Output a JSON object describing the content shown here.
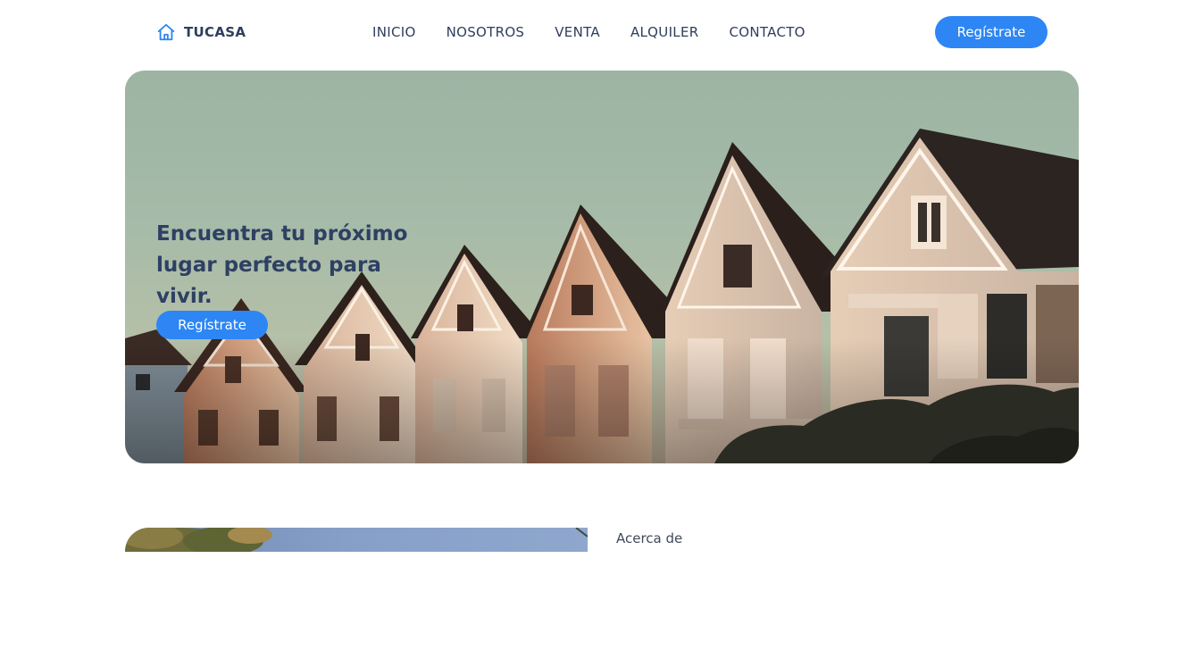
{
  "navbar": {
    "brand": "TUCASA",
    "brand_icon": "home-icon",
    "links": [
      "INICIO",
      "NOSOTROS",
      "VENTA",
      "ALQUILER",
      "CONTACTO"
    ],
    "cta_label": "Regístrate"
  },
  "hero": {
    "title": "Encuentra tu próximo lugar perfecto para vivir.",
    "cta_label": "Regístrate"
  },
  "about": {
    "label": "Acerca de"
  },
  "colors": {
    "accent": "#2d86f4",
    "text_dark": "#2e3e5c",
    "hero_title": "#2e4063"
  }
}
